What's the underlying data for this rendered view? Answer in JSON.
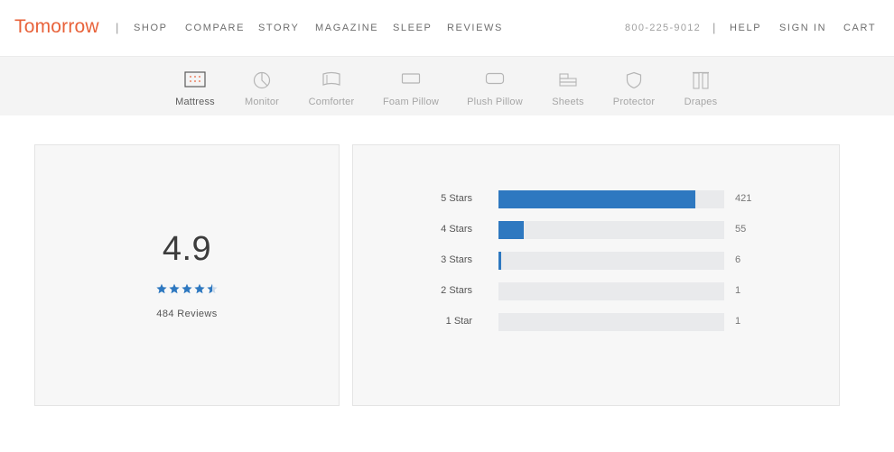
{
  "header": {
    "logo": "Tomorrow",
    "nav": [
      "SHOP",
      "COMPARE",
      "STORY",
      "MAGAZINE",
      "SLEEP",
      "REVIEWS"
    ],
    "phone": "800-225-9012",
    "right_links": [
      "HELP",
      "SIGN IN",
      "CART"
    ],
    "accent_color": "#e8623a"
  },
  "products": [
    {
      "label": "Mattress",
      "icon": "mattress-icon",
      "active": true
    },
    {
      "label": "Monitor",
      "icon": "monitor-icon",
      "active": false
    },
    {
      "label": "Comforter",
      "icon": "comforter-icon",
      "active": false
    },
    {
      "label": "Foam Pillow",
      "icon": "foam-pillow-icon",
      "active": false
    },
    {
      "label": "Plush Pillow",
      "icon": "plush-pillow-icon",
      "active": false
    },
    {
      "label": "Sheets",
      "icon": "sheets-icon",
      "active": false
    },
    {
      "label": "Protector",
      "icon": "protector-icon",
      "active": false
    },
    {
      "label": "Drapes",
      "icon": "drapes-icon",
      "active": false
    }
  ],
  "summary": {
    "average": "4.9",
    "stars_filled": 4.5,
    "review_count_text": "484 Reviews",
    "star_color": "#2e78c0"
  },
  "breakdown": {
    "bar_color": "#2e78c0",
    "track_color": "#e9eaec",
    "total_reviews": 484,
    "rows": [
      {
        "label": "5 Stars",
        "count": "421",
        "fraction": 0.87
      },
      {
        "label": "4 Stars",
        "count": "55",
        "fraction": 0.11
      },
      {
        "label": "3 Stars",
        "count": "6",
        "fraction": 0.012
      },
      {
        "label": "2 Stars",
        "count": "1",
        "fraction": 0
      },
      {
        "label": "1 Star",
        "count": "1",
        "fraction": 0
      }
    ]
  }
}
